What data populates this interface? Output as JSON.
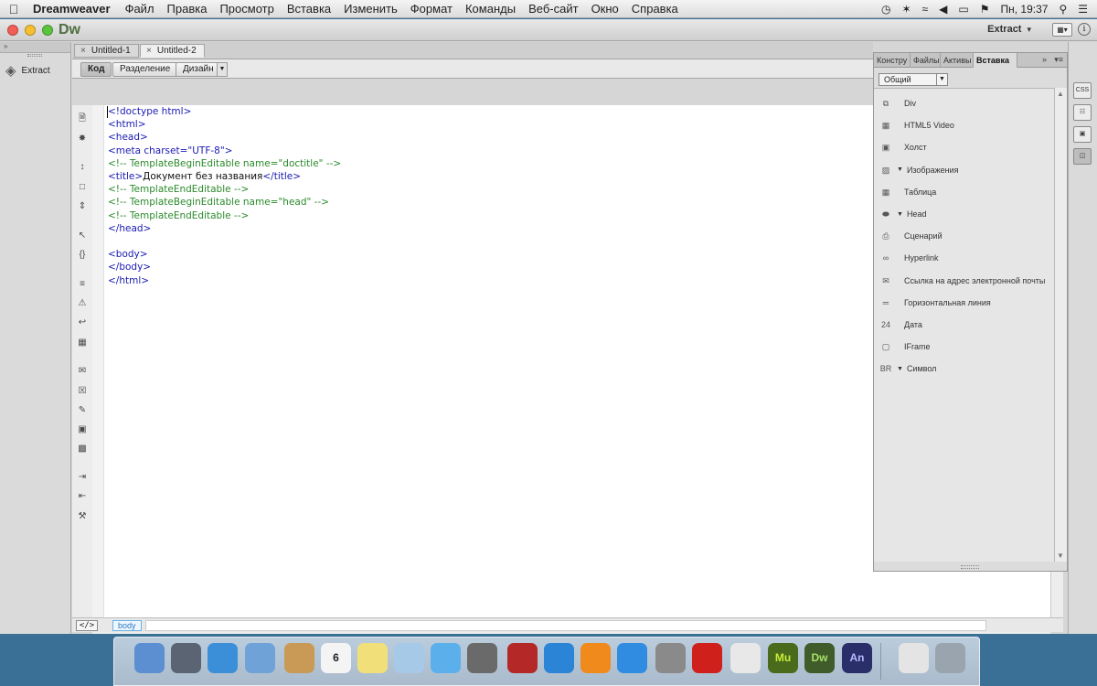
{
  "menubar": {
    "apple": "",
    "app_name": "Dreamweaver",
    "items": [
      "Файл",
      "Правка",
      "Просмотр",
      "Вставка",
      "Изменить",
      "Формат",
      "Команды",
      "Веб-сайт",
      "Окно",
      "Справка"
    ],
    "clock": "Пн, 19:37",
    "status_icons": [
      "time-machine-icon",
      "bluetooth-icon",
      "wifi-icon",
      "volume-icon",
      "battery-icon",
      "flag-us-icon",
      "spotlight-icon",
      "notification-list-icon"
    ]
  },
  "window": {
    "logo": "Dw",
    "workspace": "Extract",
    "left_panel_button": "Extract"
  },
  "tabs": [
    {
      "label": "Untitled-1"
    },
    {
      "label": "Untitled-2"
    }
  ],
  "view_buttons": {
    "code": "Код",
    "split": "Разделение",
    "design": "Дизайн"
  },
  "code_lines": [
    {
      "parts": [
        [
          "tag",
          "<!doctype html>"
        ]
      ]
    },
    {
      "parts": [
        [
          "tag",
          "<html>"
        ]
      ]
    },
    {
      "parts": [
        [
          "tag",
          "<head>"
        ]
      ]
    },
    {
      "parts": [
        [
          "tag",
          "<meta charset=\"UTF-8\">"
        ]
      ]
    },
    {
      "parts": [
        [
          "cmt",
          "<!-- TemplateBeginEditable name=\"doctitle\" -->"
        ]
      ]
    },
    {
      "parts": [
        [
          "tag",
          "<title>"
        ],
        [
          "txt",
          "Документ без названия"
        ],
        [
          "tag",
          "</title>"
        ]
      ]
    },
    {
      "parts": [
        [
          "cmt",
          "<!-- TemplateEndEditable -->"
        ]
      ]
    },
    {
      "parts": [
        [
          "cmt",
          "<!-- TemplateBeginEditable name=\"head\" -->"
        ]
      ]
    },
    {
      "parts": [
        [
          "cmt",
          "<!-- TemplateEndEditable -->"
        ]
      ]
    },
    {
      "parts": [
        [
          "tag",
          "</head>"
        ]
      ]
    },
    {
      "parts": []
    },
    {
      "parts": [
        [
          "tag",
          "<body>"
        ]
      ]
    },
    {
      "parts": [
        [
          "tag",
          "</body>"
        ]
      ]
    },
    {
      "parts": [
        [
          "tag",
          "</html>"
        ]
      ]
    }
  ],
  "statusbar": {
    "code_symbol": "</>",
    "tag": "body"
  },
  "insert_panel": {
    "tabs": [
      "Констру",
      "Файлы",
      "Активы",
      "Вставка"
    ],
    "category": "Общий",
    "items": [
      {
        "icon": "div-icon",
        "label": "Div",
        "dropdown": false
      },
      {
        "icon": "html5-video-icon",
        "label": "HTML5 Video",
        "dropdown": false
      },
      {
        "icon": "canvas-icon",
        "label": "Холст",
        "dropdown": false
      },
      {
        "icon": "image-icon",
        "label": "Изображения",
        "dropdown": true
      },
      {
        "icon": "table-icon",
        "label": "Таблица",
        "dropdown": false
      },
      {
        "icon": "head-tag-icon",
        "label": "Head",
        "dropdown": true
      },
      {
        "icon": "script-icon",
        "label": "Сценарий",
        "dropdown": false
      },
      {
        "icon": "hyperlink-icon",
        "label": "Hyperlink",
        "dropdown": false
      },
      {
        "icon": "email-link-icon",
        "label": "Ссылка на адрес электронной почты",
        "dropdown": false
      },
      {
        "icon": "horizontal-rule-icon",
        "label": "Горизонтальная линия",
        "dropdown": false
      },
      {
        "icon": "date-icon",
        "label": "Дата",
        "dropdown": false
      },
      {
        "icon": "iframe-icon",
        "label": "IFrame",
        "dropdown": false
      },
      {
        "icon": "character-icon",
        "label": "Символ",
        "dropdown": true
      }
    ]
  },
  "right_strip": {
    "css_label": "CSS"
  },
  "dock": {
    "items": [
      {
        "name": "finder",
        "label": "",
        "color": "#5b8fd1"
      },
      {
        "name": "launchpad",
        "label": "",
        "color": "#5a6472"
      },
      {
        "name": "safari",
        "label": "",
        "color": "#3a8fd8"
      },
      {
        "name": "mail",
        "label": "",
        "color": "#6fa3d8"
      },
      {
        "name": "contacts",
        "label": "",
        "color": "#c99a55"
      },
      {
        "name": "calendar",
        "label": "6",
        "color": "#f4f4f4"
      },
      {
        "name": "notes",
        "label": "",
        "color": "#f1e07a"
      },
      {
        "name": "preview",
        "label": "",
        "color": "#a6c9e8"
      },
      {
        "name": "messages",
        "label": "",
        "color": "#5bb0ec"
      },
      {
        "name": "facetime",
        "label": "",
        "color": "#6a6a6a"
      },
      {
        "name": "photo-booth",
        "label": "",
        "color": "#b42828"
      },
      {
        "name": "itunes",
        "label": "",
        "color": "#2b84d6"
      },
      {
        "name": "ibooks",
        "label": "",
        "color": "#f08a1c"
      },
      {
        "name": "app-store",
        "label": "",
        "color": "#2f8ce0"
      },
      {
        "name": "system-preferences",
        "label": "",
        "color": "#8a8a8a"
      },
      {
        "name": "acrobat",
        "label": "",
        "color": "#d0201c"
      },
      {
        "name": "textedit",
        "label": "",
        "color": "#e8e8e8"
      },
      {
        "name": "muse",
        "label": "Mu",
        "color": "#4a6a1c"
      },
      {
        "name": "dreamweaver",
        "label": "Dw",
        "color": "#3f5c2a"
      },
      {
        "name": "animate",
        "label": "An",
        "color": "#2a2f6a"
      },
      {
        "name": "documents",
        "label": "",
        "color": "#e4e4e4"
      },
      {
        "name": "trash",
        "label": "",
        "color": "#9aa4ae"
      }
    ]
  }
}
